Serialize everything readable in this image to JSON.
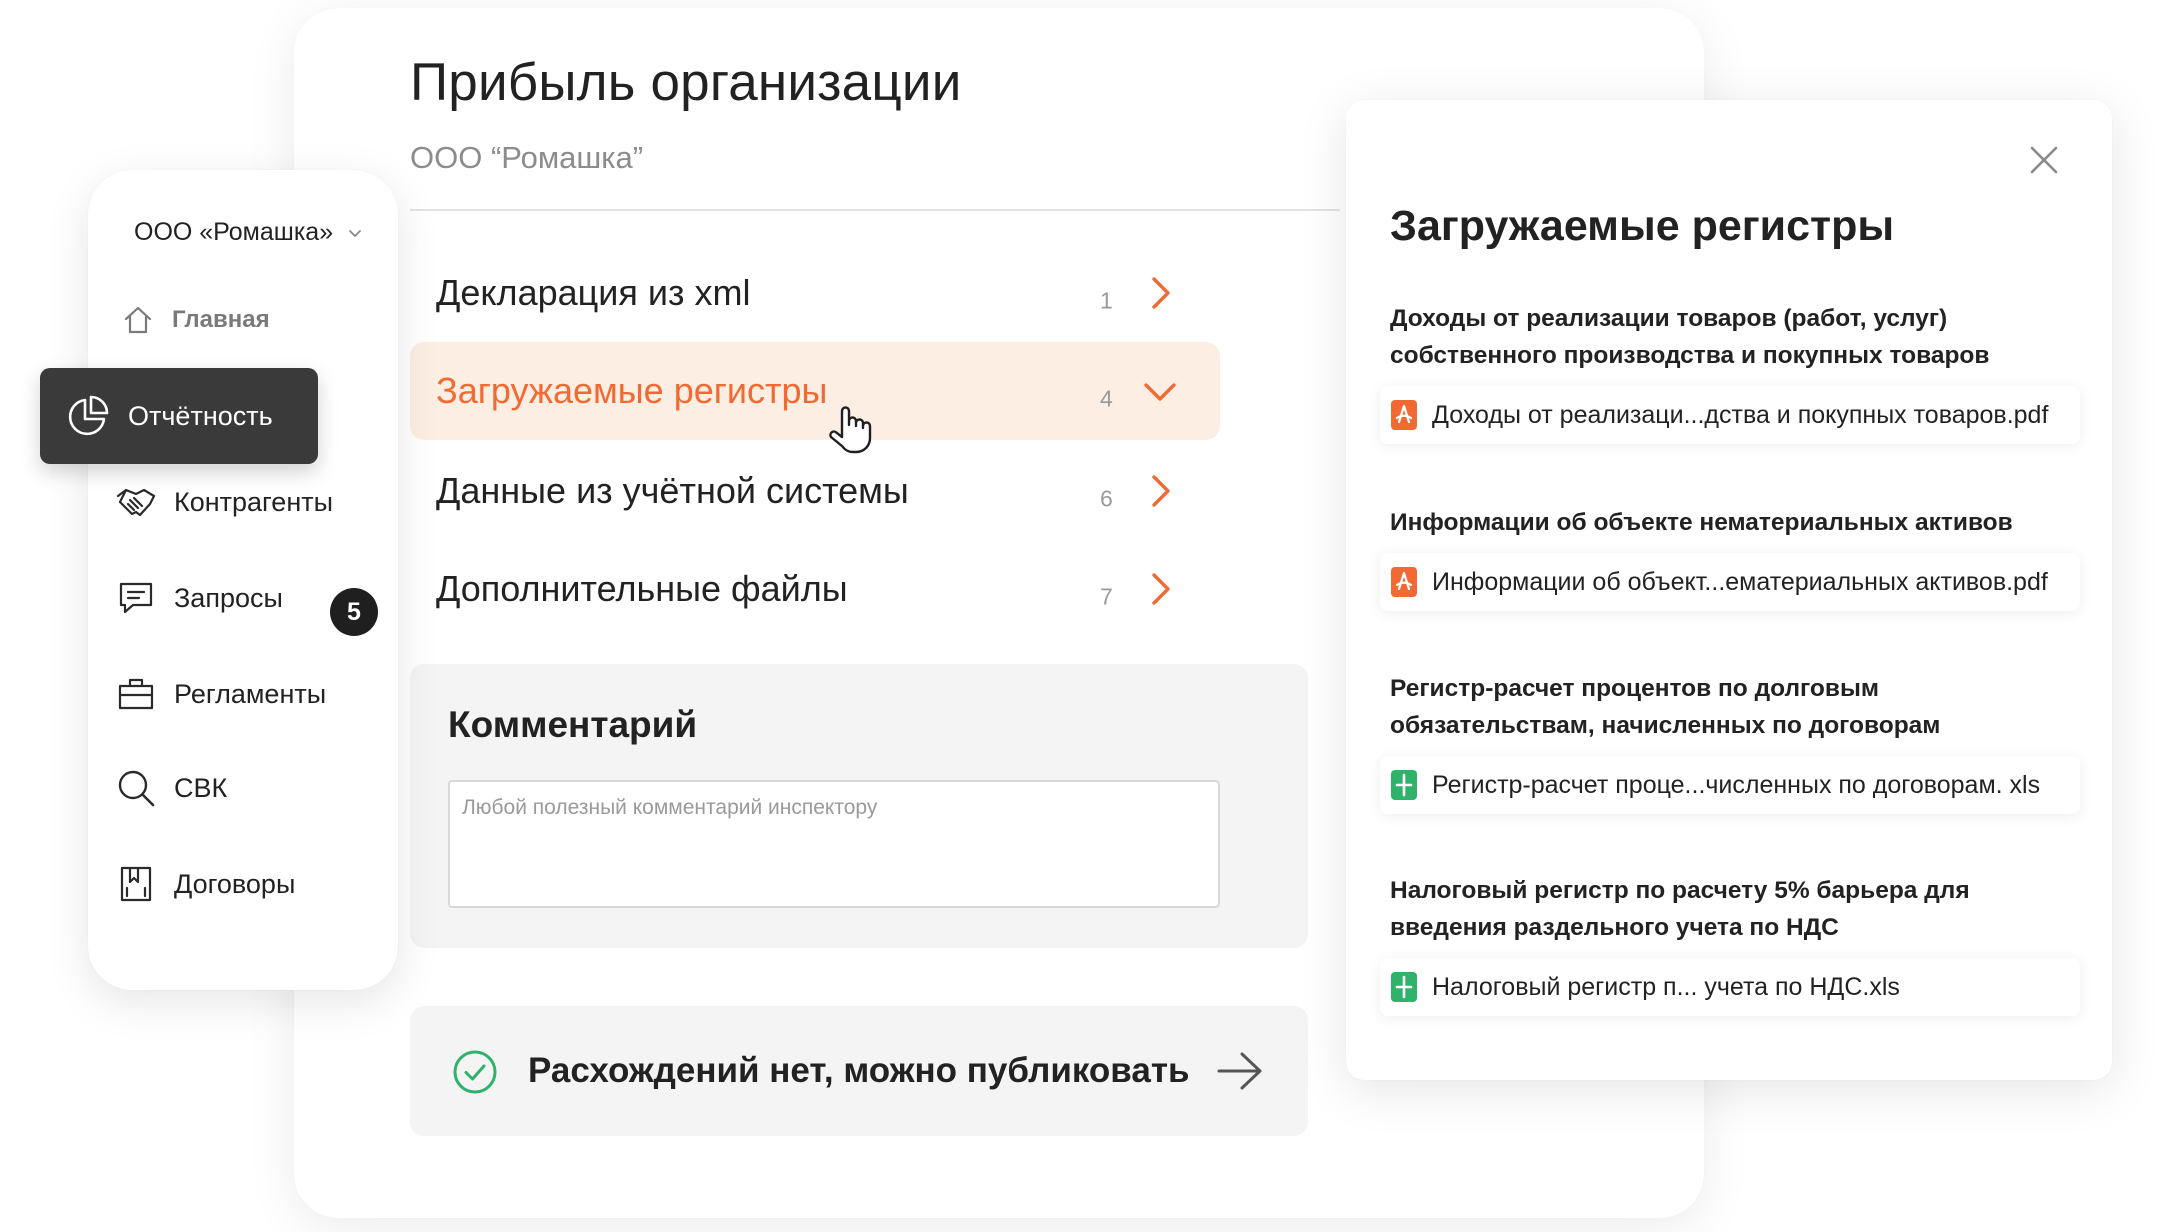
{
  "colors": {
    "accent": "#f26a33",
    "active_row_bg": "#fdeee4",
    "nav_active_bg": "#3a3a3a",
    "success": "#2fb36b",
    "pdf": "#f26a33",
    "xls": "#2fb36b"
  },
  "page": {
    "title": "Прибыль организации",
    "subtitle": "ООО “Ромашка”"
  },
  "sections": [
    {
      "label": "Декларация из xml",
      "count": "1",
      "chevron": "chevron-right-icon",
      "active": false
    },
    {
      "label": "Загружаемые регистры",
      "count": "4",
      "chevron": "chevron-down-icon",
      "active": true
    },
    {
      "label": "Данные из учётной системы",
      "count": "6",
      "chevron": "chevron-right-icon",
      "active": false
    },
    {
      "label": "Дополнительные файлы",
      "count": "7",
      "chevron": "chevron-right-icon",
      "active": false
    }
  ],
  "comment": {
    "heading": "Комментарий",
    "placeholder": "Любой полезный комментарий инспектору",
    "value": ""
  },
  "publish": {
    "text": "Расхождений нет, можно публиковать"
  },
  "sidebar": {
    "org": "ООО «Ромашка»",
    "home": "Главная",
    "active": "Отчётность",
    "items": [
      {
        "label": "Контрагенты",
        "icon": "handshake-icon"
      },
      {
        "label": "Запросы",
        "icon": "chat-icon",
        "badge": "5"
      },
      {
        "label": "Регламенты",
        "icon": "briefcase-icon"
      },
      {
        "label": "СВК",
        "icon": "search-icon"
      },
      {
        "label": "Договоры",
        "icon": "contracts-icon"
      }
    ]
  },
  "registers": {
    "title": "Загружаемые регистры",
    "groups": [
      {
        "heading": "Доходы от реализации товаров (работ, услуг) собственного производства и покупных товаров",
        "file": "Доходы от реализаци...дства и покупных товаров.pdf",
        "type": "pdf"
      },
      {
        "heading": "Информации об объекте нематериальных активов",
        "file": "Информации об объект...ематериальных активов.pdf",
        "type": "pdf"
      },
      {
        "heading": "Регистр-расчет процентов по долговым обязательствам, начисленных по договорам",
        "file": "Регистр-расчет проце...численных по договорам. xls",
        "type": "xls"
      },
      {
        "heading": "Налоговый регистр по расчету 5% барьера для введения раздельного учета по НДС",
        "file": "Налоговый регистр п... учета по НДС.xls",
        "type": "xls"
      }
    ]
  }
}
